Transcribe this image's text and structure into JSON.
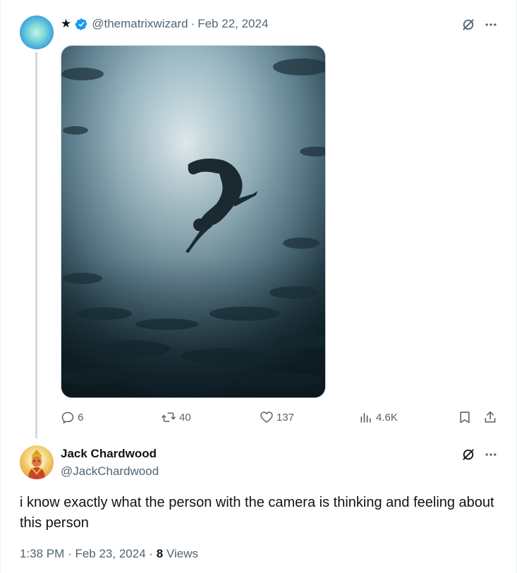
{
  "parent_tweet": {
    "name_symbol": "★",
    "handle": "@thematrixwizard",
    "separator": "·",
    "date": "Feb 22, 2024",
    "verified": true,
    "media_alt": "underwater-swimmer-photo",
    "actions": {
      "reply_count": "6",
      "repost_count": "40",
      "like_count": "137",
      "views_count": "4.6K"
    },
    "icons": [
      "reply-icon",
      "repost-icon",
      "like-icon",
      "views-icon",
      "bookmark-icon",
      "share-icon",
      "grok-icon",
      "more-icon"
    ]
  },
  "reply_tweet": {
    "name": "Jack Chardwood",
    "handle": "@JackChardwood",
    "text": "i know exactly what the person with the camera is thinking and feeling about this person",
    "time": "1:38 PM",
    "separator": "·",
    "date": "Feb 23, 2024",
    "separator2": "·",
    "views_count": "8",
    "views_label": "Views"
  },
  "colors": {
    "secondary_text": "#536471",
    "primary_text": "#0f1419",
    "verified_blue": "#1d9bf0",
    "thread_line": "#cfd9de"
  }
}
